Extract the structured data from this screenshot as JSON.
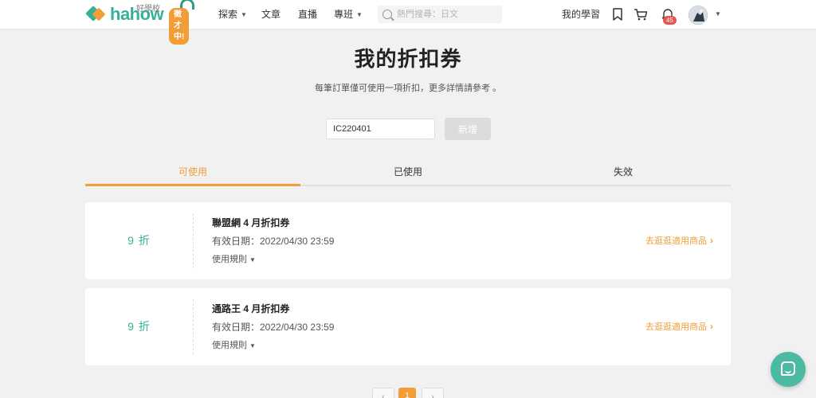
{
  "header": {
    "logo_text": "hahow",
    "logo_small": "好學校",
    "recruit_badge": "徵才中!",
    "nav": [
      {
        "label": "探索",
        "has_caret": true
      },
      {
        "label": "文章",
        "has_caret": false
      },
      {
        "label": "直播",
        "has_caret": false
      },
      {
        "label": "專班",
        "has_caret": true
      }
    ],
    "search_placeholder": "熱門搜尋：日文",
    "my_learning": "我的學習",
    "notification_count": "45"
  },
  "page": {
    "title": "我的折扣券",
    "subtitle": "每筆訂單僅可使用一項折扣，更多詳情請參考 。",
    "code_input_value": "IC220401",
    "add_button": "新增"
  },
  "tabs": [
    {
      "label": "可使用",
      "active": true
    },
    {
      "label": "已使用",
      "active": false
    },
    {
      "label": "失效",
      "active": false
    }
  ],
  "coupons": [
    {
      "discount": "9 折",
      "name": "聯盟網 4 月折扣券",
      "expiry": "有效日期：2022/04/30 23:59",
      "rules": "使用規則",
      "browse": "去逛逛適用商品"
    },
    {
      "discount": "9 折",
      "name": "通路王 4 月折扣券",
      "expiry": "有效日期：2022/04/30 23:59",
      "rules": "使用規則",
      "browse": "去逛逛適用商品"
    }
  ],
  "pagination": {
    "current_page": "1"
  },
  "colors": {
    "brand_green": "#36b197",
    "brand_orange": "#f29d38",
    "chat_button": "#4bb9a3"
  }
}
